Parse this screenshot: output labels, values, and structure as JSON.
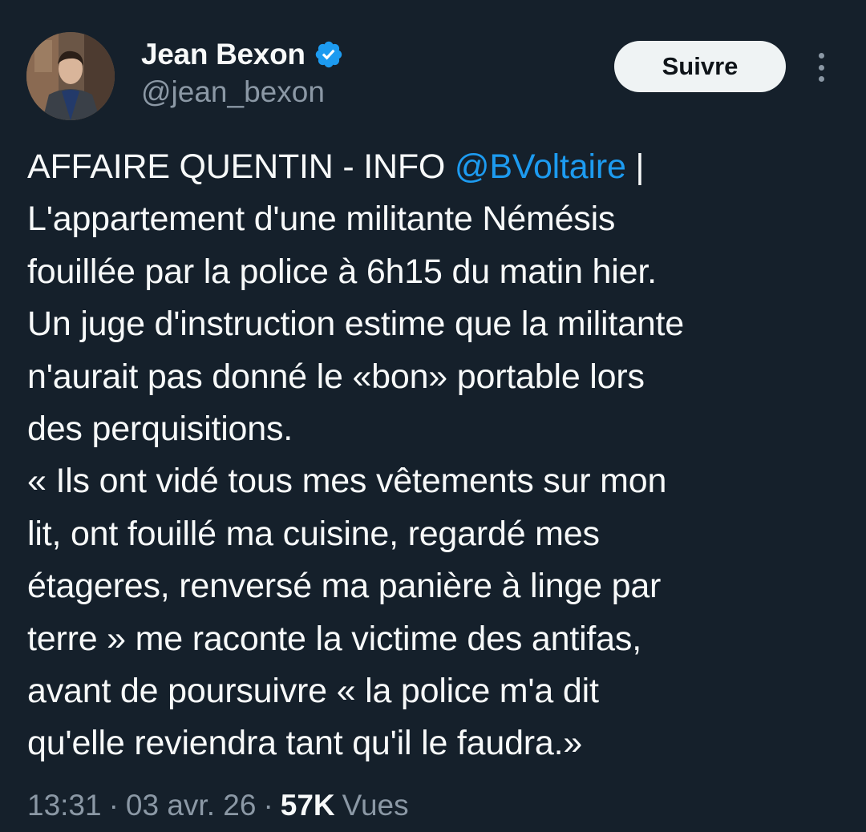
{
  "author": {
    "display_name": "Jean Bexon",
    "handle": "@jean_bexon",
    "verified": true,
    "avatar_icon": "profile-photo"
  },
  "actions": {
    "follow_label": "Suivre",
    "more_icon": "more-vertical-icon"
  },
  "tweet": {
    "lines": [
      {
        "before": "AFFAIRE QUENTIN - INFO ",
        "mention": "@BVoltaire",
        "after": " |"
      },
      {
        "text": "L'appartement d'une militante Némésis"
      },
      {
        "text": "fouillée par la police à 6h15 du matin hier."
      },
      {
        "text": "Un juge d'instruction estime que la militante"
      },
      {
        "text": "n'aurait pas donné le «bon» portable lors"
      },
      {
        "text": "des perquisitions."
      },
      {
        "text": "« Ils ont vidé tous mes vêtements sur mon"
      },
      {
        "text": "lit, ont fouillé ma cuisine, regardé mes"
      },
      {
        "text": "étageres, renversé ma panière à linge par"
      },
      {
        "text": "terre » me raconte la victime des antifas,"
      },
      {
        "text": "avant de poursuivre « la police m'a dit"
      },
      {
        "text": "qu'elle reviendra tant qu'il le faudra.»"
      }
    ]
  },
  "meta": {
    "time": "13:31",
    "separator": "·",
    "date": "03 avr. 26",
    "views_count": "57K",
    "views_label": "Vues"
  },
  "colors": {
    "background": "#15202b",
    "text": "#f7f9f9",
    "secondary": "#8b98a5",
    "link": "#1d9bf0",
    "verified": "#1d9bf0"
  }
}
